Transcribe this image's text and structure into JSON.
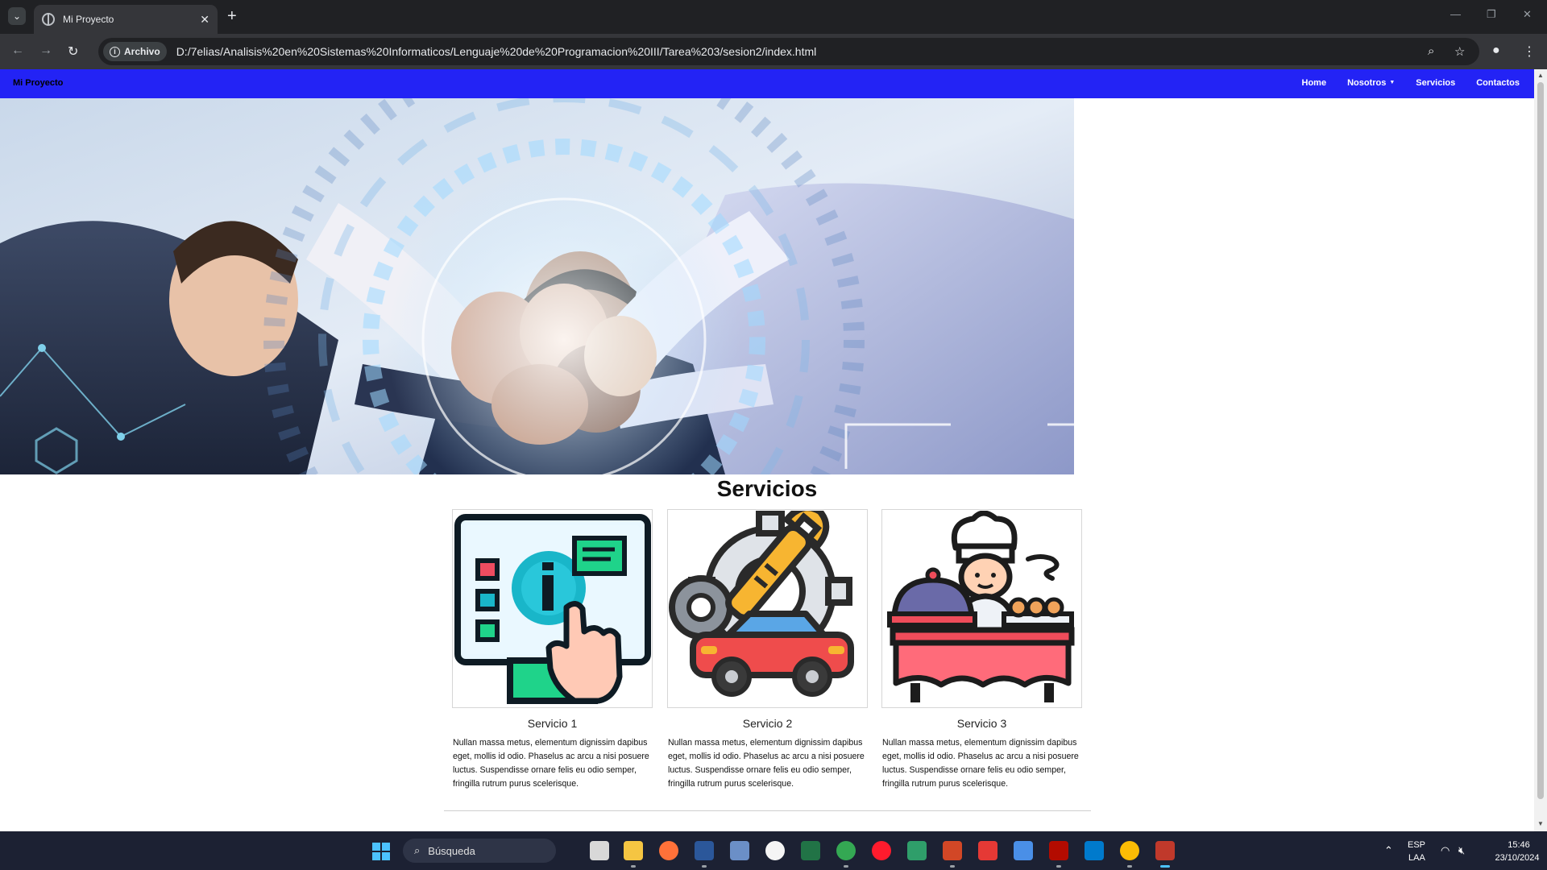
{
  "browser": {
    "tab_title": "Mi Proyecto",
    "new_tab_label": "+",
    "site_chip_label": "Archivo",
    "url": "D:/7elias/Analisis%20en%20Sistemas%20Informaticos/Lenguaje%20de%20Programacion%20III/Tarea%203/sesion2/index.html"
  },
  "navbar": {
    "brand": "Mi Proyecto",
    "links": [
      "Home",
      "Nosotros",
      "Servicios",
      "Contactos"
    ],
    "bg_color": "#2323f5"
  },
  "services": {
    "title": "Servicios",
    "cards": [
      {
        "title": "Servicio 1",
        "icon": "touch-screen-info-icon",
        "text": "Nullan massa metus, elementum dignissim dapibus eget, mollis id odio. Phaselus ac arcu a nisi posuere luctus. Suspendisse ornare felis eu odio semper, fringilla rutrum purus scelerisque."
      },
      {
        "title": "Servicio 2",
        "icon": "car-repair-icon",
        "text": "Nullan massa metus, elementum dignissim dapibus eget, mollis id odio. Phaselus ac arcu a nisi posuere luctus. Suspendisse ornare felis eu odio semper, fringilla rutrum purus scelerisque."
      },
      {
        "title": "Servicio 3",
        "icon": "chef-catering-icon",
        "text": "Nullan massa metus, elementum dignissim dapibus eget, mollis id odio. Phaselus ac arcu a nisi posuere luctus. Suspendisse ornare felis eu odio semper, fringilla rutrum purus scelerisque."
      }
    ]
  },
  "taskbar": {
    "search_placeholder": "Búsqueda",
    "lang_top": "ESP",
    "lang_bottom": "LAA",
    "time": "15:46",
    "date": "23/10/2024"
  }
}
